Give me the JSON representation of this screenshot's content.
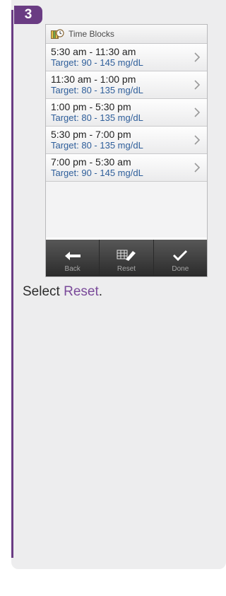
{
  "step": {
    "number": "3"
  },
  "screen": {
    "title": "Time Blocks",
    "rows": [
      {
        "time": "5:30 am - 11:30 am",
        "target": "Target: 90 - 145 mg/dL"
      },
      {
        "time": "11:30 am - 1:00 pm",
        "target": "Target: 80 - 135 mg/dL"
      },
      {
        "time": "1:00 pm - 5:30 pm",
        "target": "Target: 80 - 135 mg/dL"
      },
      {
        "time": "5:30 pm - 7:00 pm",
        "target": "Target: 80 - 135 mg/dL"
      },
      {
        "time": "7:00 pm - 5:30 am",
        "target": "Target: 90 - 145 mg/dL"
      }
    ],
    "footer": {
      "back": "Back",
      "reset": "Reset",
      "done": "Done"
    }
  },
  "instruction": {
    "prefix": "Select ",
    "link": "Reset",
    "suffix": "."
  },
  "colors": {
    "accent": "#6a3c83",
    "target_text": "#2e5e9a",
    "panel": "#ededee"
  }
}
